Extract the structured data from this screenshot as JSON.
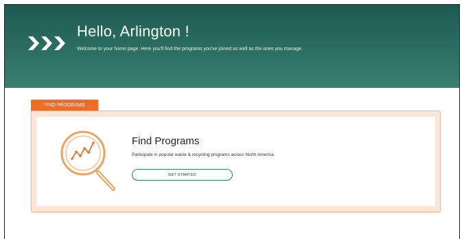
{
  "hero": {
    "greeting": "Hello, Arlington !",
    "subtitle": "Welcome to your home page. Here you'll find the programs you've joined as well as the ones you manage.",
    "icon": "triple-chevron-right-icon"
  },
  "section": {
    "tab_label": "FIND PROGRAMS"
  },
  "card": {
    "title": "Find Programs",
    "description": "Participate in popular waste & recycling programs across North America.",
    "button_label": "GET STARTED",
    "icon": "magnifier-chart-icon"
  },
  "colors": {
    "hero_dark": "#1e5a52",
    "hero_light": "#3a806f",
    "accent_orange": "#f26b27",
    "card_peach": "#fde6d6",
    "button_border": "#2f7a6a"
  }
}
